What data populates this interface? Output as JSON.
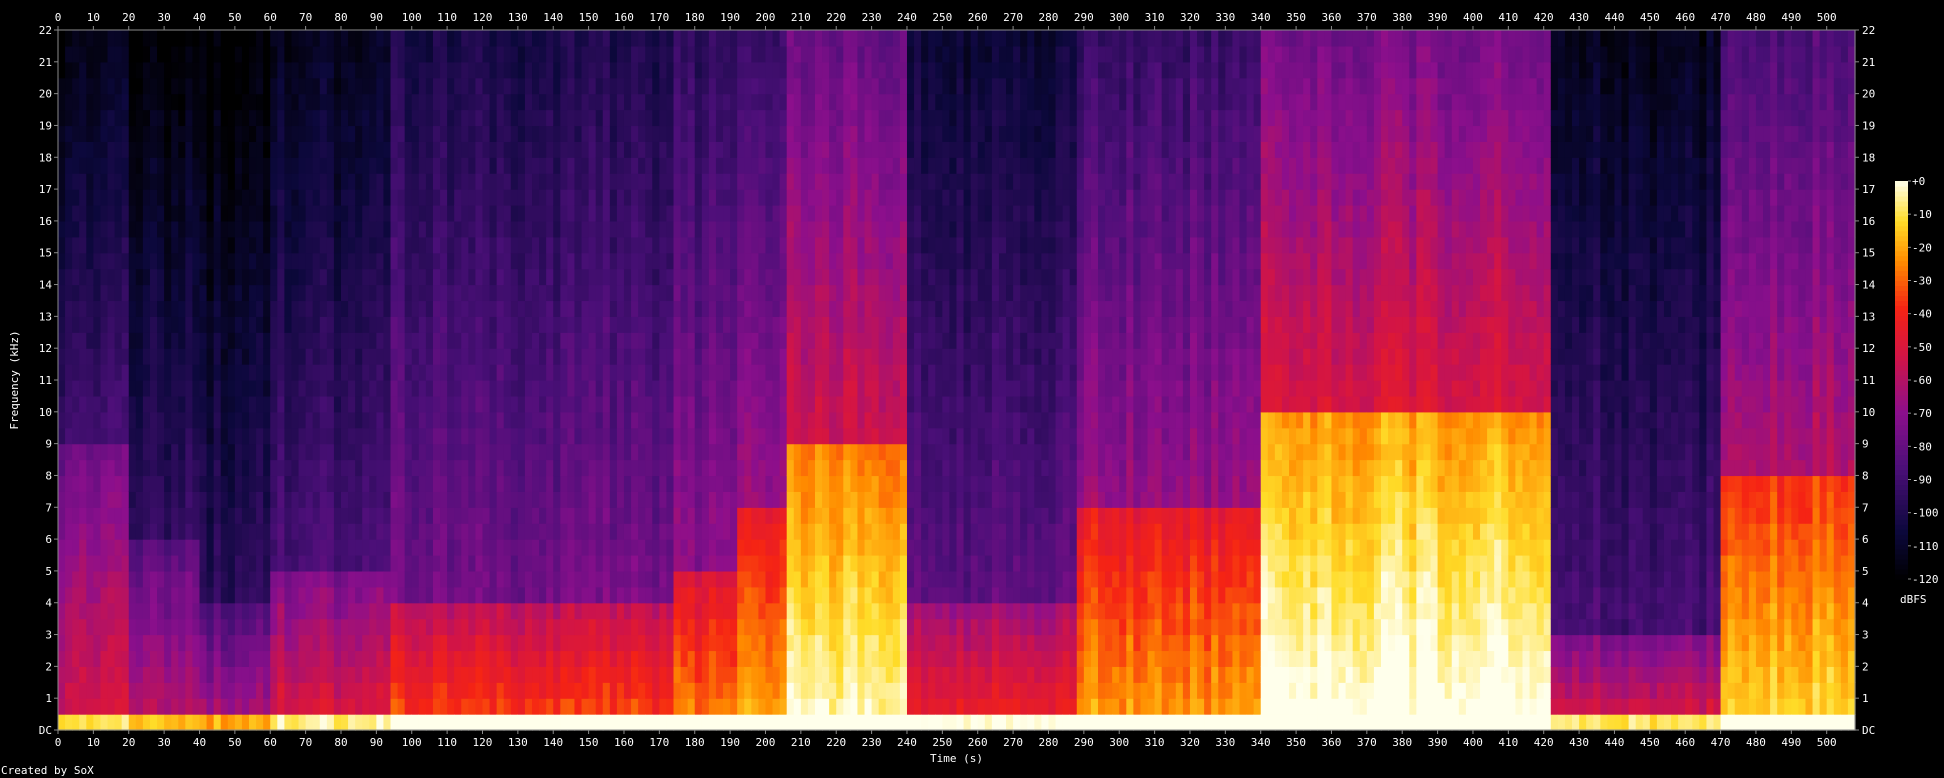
{
  "chart_data": {
    "type": "heatmap",
    "title": "",
    "xlabel": "Time (s)",
    "ylabel": "Frequency (kHz)",
    "xlim": [
      0,
      508
    ],
    "ylim": [
      0,
      22
    ],
    "x_ticks": [
      "0",
      "10",
      "20",
      "30",
      "40",
      "50",
      "60",
      "70",
      "80",
      "90",
      "100",
      "110",
      "120",
      "130",
      "140",
      "150",
      "160",
      "170",
      "180",
      "190",
      "200",
      "210",
      "220",
      "230",
      "240",
      "250",
      "260",
      "270",
      "280",
      "290",
      "300",
      "310",
      "320",
      "330",
      "340",
      "350",
      "360",
      "370",
      "380",
      "390",
      "400",
      "410",
      "420",
      "430",
      "440",
      "450",
      "460",
      "470",
      "480",
      "490",
      "500"
    ],
    "y_ticks": [
      "DC",
      "1",
      "2",
      "3",
      "4",
      "5",
      "6",
      "7",
      "8",
      "9",
      "10",
      "11",
      "12",
      "13",
      "14",
      "15",
      "16",
      "17",
      "18",
      "19",
      "20",
      "21",
      "22"
    ],
    "colorbar": {
      "label": "dBFS",
      "range": [
        -120,
        0
      ],
      "ticks": [
        "+0",
        "-10",
        "-20",
        "-30",
        "-40",
        "-50",
        "-60",
        "-70",
        "-80",
        "-90",
        "-100",
        "-110",
        "-120"
      ]
    },
    "segments": [
      {
        "t0": 0,
        "t1": 20,
        "cutoff_khz": 9,
        "intensity": 0.35
      },
      {
        "t0": 20,
        "t1": 40,
        "cutoff_khz": 6,
        "intensity": 0.3
      },
      {
        "t0": 40,
        "t1": 61,
        "cutoff_khz": 4,
        "intensity": 0.28
      },
      {
        "t0": 61,
        "t1": 95,
        "cutoff_khz": 5,
        "intensity": 0.38
      },
      {
        "t0": 95,
        "t1": 175,
        "cutoff_khz": 4,
        "intensity": 0.52
      },
      {
        "t0": 175,
        "t1": 192,
        "cutoff_khz": 5,
        "intensity": 0.58
      },
      {
        "t0": 192,
        "t1": 207,
        "cutoff_khz": 7,
        "intensity": 0.65
      },
      {
        "t0": 207,
        "t1": 241,
        "cutoff_khz": 9,
        "intensity": 0.78
      },
      {
        "t0": 241,
        "t1": 288,
        "cutoff_khz": 4,
        "intensity": 0.45
      },
      {
        "t0": 288,
        "t1": 340,
        "cutoff_khz": 7,
        "intensity": 0.62
      },
      {
        "t0": 340,
        "t1": 422,
        "cutoff_khz": 10,
        "intensity": 0.82
      },
      {
        "t0": 422,
        "t1": 470,
        "cutoff_khz": 3,
        "intensity": 0.38
      },
      {
        "t0": 470,
        "t1": 508,
        "cutoff_khz": 8,
        "intensity": 0.7
      }
    ]
  },
  "footer": {
    "credit": "Created by SoX"
  }
}
